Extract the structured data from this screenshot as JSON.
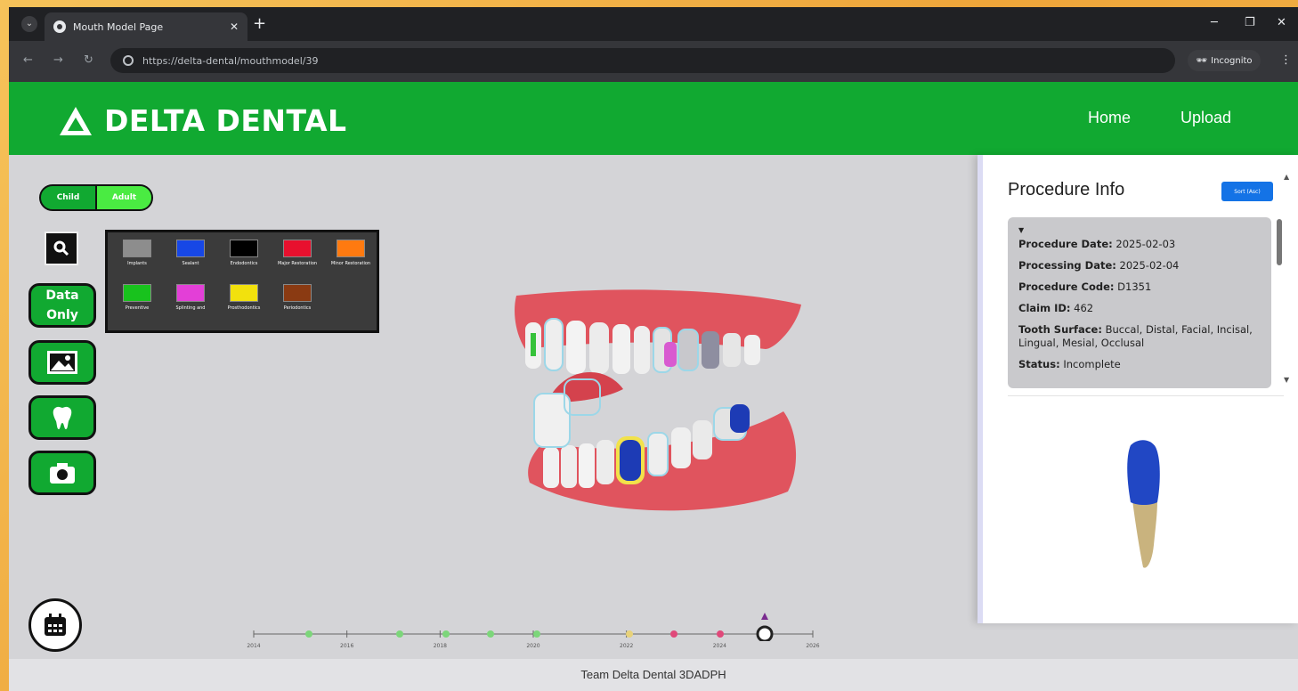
{
  "browser": {
    "tab_title": "Mouth Model Page",
    "url": "https://delta-dental/mouthmodel/39",
    "incognito_label": "Incognito"
  },
  "header": {
    "brand": "DELTA DENTAL",
    "nav": [
      "Home",
      "Upload"
    ]
  },
  "toggle": {
    "child_label": "Child",
    "adult_label": "Adult",
    "selected": "Adult"
  },
  "sidebar": {
    "data_only_label_1": "Data",
    "data_only_label_2": "Only"
  },
  "legend": [
    {
      "label": "Implants",
      "color": "#8d8d8d"
    },
    {
      "label": "Sealant",
      "color": "#1747e6"
    },
    {
      "label": "Endodontics",
      "color": "#000000"
    },
    {
      "label": "Major Restoration",
      "color": "#e8102e"
    },
    {
      "label": "Minor Restoration",
      "color": "#ff7a10"
    },
    {
      "label": "Preventive",
      "color": "#18c21d"
    },
    {
      "label": "Splinting and",
      "color": "#e33fd7"
    },
    {
      "label": "Prosthodontics",
      "color": "#f2e10d"
    },
    {
      "label": "Periodontics",
      "color": "#8a3a12"
    }
  ],
  "timeline": {
    "years": [
      "2014",
      "2016",
      "2018",
      "2020",
      "2022",
      "2024",
      "2026"
    ],
    "marker_colors": [
      "#7cd67a",
      "#7cd67a",
      "#7cd67a",
      "#7cd67a",
      "#7cd67a",
      "#e8d27a",
      "#e0497a",
      "#e0497a"
    ]
  },
  "panel": {
    "title": "Procedure Info",
    "sort_label": "Sort (Asc)",
    "procedure_date_label": "Procedure Date:",
    "procedure_date": "2025-02-03",
    "processing_date_label": "Processing Date:",
    "processing_date": "2025-02-04",
    "procedure_code_label": "Procedure Code:",
    "procedure_code": "D1351",
    "claim_id_label": "Claim ID:",
    "claim_id": "462",
    "tooth_surface_label": "Tooth Surface:",
    "tooth_surface": "Buccal, Distal, Facial, Incisal, Lingual, Mesial, Occlusal",
    "status_label": "Status:",
    "status": "Incomplete"
  },
  "footer": {
    "text": "Team Delta Dental 3DADPH"
  }
}
